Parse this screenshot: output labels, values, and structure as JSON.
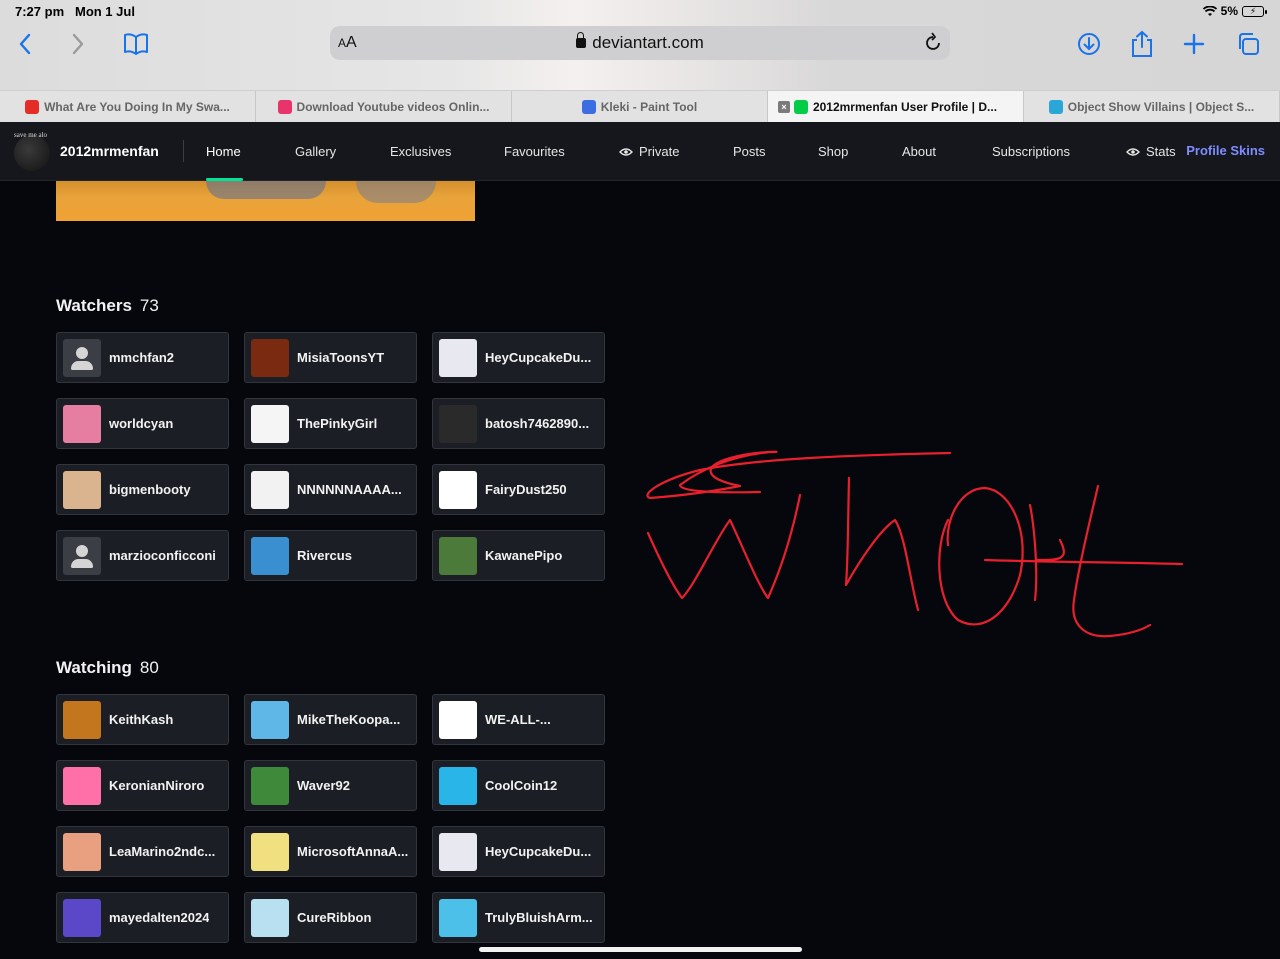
{
  "status_bar": {
    "time": "7:27 pm",
    "date": "Mon 1 Jul",
    "battery": "5%"
  },
  "browser": {
    "reader_label": "AA",
    "url": "deviantart.com",
    "tabs": [
      {
        "title": "What Are You Doing In My Swa...",
        "icon_color": "#e52d27",
        "icon": "youtube-icon"
      },
      {
        "title": "Download Youtube videos Onlin...",
        "icon_color": "#e8336b",
        "icon": "download-icon"
      },
      {
        "title": "Kleki - Paint Tool",
        "icon_color": "#3b6ee0",
        "icon": "kleki-icon"
      },
      {
        "title": "2012mrmenfan User Profile | D...",
        "icon_color": "#05cc47",
        "icon": "deviantart-icon",
        "active": true
      },
      {
        "title": "Object Show Villains | Object S...",
        "icon_color": "#2aa6d9",
        "icon": "fandom-icon"
      }
    ]
  },
  "profile": {
    "username": "2012mrmenfan",
    "avatar_caption": "save me alo",
    "nav": [
      "Home",
      "Gallery",
      "Exclusives",
      "Favourites",
      "Private",
      "Posts",
      "Shop",
      "About",
      "Subscriptions",
      "Stats"
    ],
    "profile_skins": "Profile Skins"
  },
  "watchers": {
    "title": "Watchers",
    "count": "73",
    "items": [
      {
        "name": "mmchfan2",
        "avatar": "default"
      },
      {
        "name": "MisiaToonsYT",
        "avatar": "#7a2a10"
      },
      {
        "name": "HeyCupcakeDu...",
        "avatar": "#e8e8f0"
      },
      {
        "name": "worldcyan",
        "avatar": "#e57ea0"
      },
      {
        "name": "ThePinkyGirl",
        "avatar": "#f5f5f5"
      },
      {
        "name": "batosh7462890...",
        "avatar": "#2a2a2a"
      },
      {
        "name": "bigmenbooty",
        "avatar": "#d9b48e"
      },
      {
        "name": "NNNNNNAAAA...",
        "avatar": "#f2f2f2"
      },
      {
        "name": "FairyDust250",
        "avatar": "#ffffff"
      },
      {
        "name": "marzioconficconi",
        "avatar": "default"
      },
      {
        "name": "Rivercus",
        "avatar": "#3a8fd0"
      },
      {
        "name": "KawanePipo",
        "avatar": "#4c7a3a"
      }
    ]
  },
  "watching": {
    "title": "Watching",
    "count": "80",
    "items": [
      {
        "name": "KeithKash",
        "avatar": "#c4761e"
      },
      {
        "name": "MikeTheKoopa...",
        "avatar": "#5fb7e8"
      },
      {
        "name": "WE-ALL-...",
        "avatar": "#ffffff"
      },
      {
        "name": "KeronianNiroro",
        "avatar": "#ff6fa8"
      },
      {
        "name": "Waver92",
        "avatar": "#3f8a3a"
      },
      {
        "name": "CoolCoin12",
        "avatar": "#2ab5e8"
      },
      {
        "name": "LeaMarino2ndc...",
        "avatar": "#e8a080"
      },
      {
        "name": "MicrosoftAnnaA...",
        "avatar": "#f0e080"
      },
      {
        "name": "HeyCupcakeDu...",
        "avatar": "#e8e8f0"
      },
      {
        "name": "mayedalten2024",
        "avatar": "#5a48c8"
      },
      {
        "name": "CureRibbon",
        "avatar": "#b8e0f0"
      },
      {
        "name": "TrulyBluishArm...",
        "avatar": "#4cc0e8"
      }
    ]
  },
  "annotation": {
    "color": "#e8202e"
  },
  "colors": {
    "accent": "#00e59b",
    "skins_link": "#7f8cff",
    "ios_blue": "#1a73e8"
  }
}
